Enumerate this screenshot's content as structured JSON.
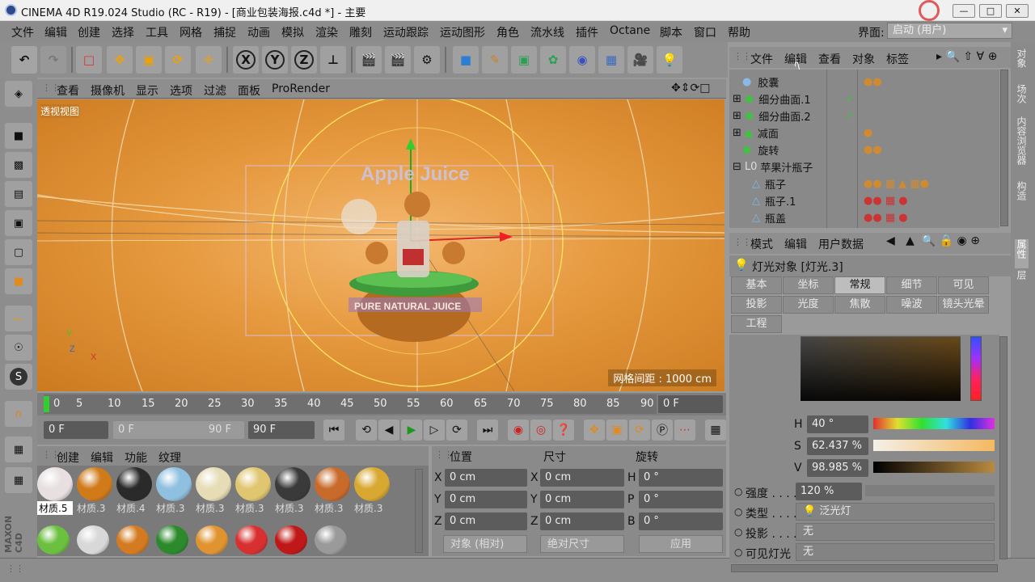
{
  "window": {
    "title": "CINEMA 4D R19.024 Studio (RC - R19) - [商业包装海报.c4d *] - 主要"
  },
  "menu": [
    "文件",
    "编辑",
    "创建",
    "选择",
    "工具",
    "网格",
    "捕捉",
    "动画",
    "模拟",
    "渲染",
    "雕刻",
    "运动跟踪",
    "运动图形",
    "角色",
    "流水线",
    "插件",
    "Octane",
    "脚本",
    "窗口",
    "帮助"
  ],
  "layout": {
    "label": "界面:",
    "value": "启动 (用户)"
  },
  "toolbar": {
    "axis_x": "X",
    "axis_y": "Y",
    "axis_z": "Z"
  },
  "viewport": {
    "menu": [
      "查看",
      "摄像机",
      "显示",
      "选项",
      "过滤",
      "面板",
      "ProRender"
    ],
    "label": "透视视图",
    "grid": "网格间距 : 1000 cm",
    "logo_text": "Apple Juice",
    "label_text": "PURE NATURAL JUICE",
    "axis_y": "Y",
    "axis_z": "Z",
    "axis_x": "X"
  },
  "timeline": {
    "ticks": [
      "0",
      "5",
      "10",
      "15",
      "20",
      "25",
      "30",
      "35",
      "40",
      "45",
      "50",
      "55",
      "60",
      "65",
      "70",
      "75",
      "80",
      "85",
      "90"
    ],
    "frame": "0 F",
    "start": "0 F",
    "range_start": "0 F",
    "range_end": "90 F",
    "end": "90 F"
  },
  "materials": {
    "menu": [
      "创建",
      "编辑",
      "功能",
      "纹理"
    ],
    "row1": [
      {
        "name": "材质.5",
        "color": "#e8e0e0"
      },
      {
        "name": "材质.3",
        "color": "#d07a1a"
      },
      {
        "name": "材质.4",
        "color": "#2a2a2a"
      },
      {
        "name": "材质.3",
        "color": "#8fc0e0"
      },
      {
        "name": "材质.3",
        "color": "#e6dcb6"
      },
      {
        "name": "材质.3",
        "color": "#e0c670"
      },
      {
        "name": "材质.3",
        "color": "#3a3a3a"
      },
      {
        "name": "材质.3",
        "color": "#c86a2a"
      },
      {
        "name": "材质.3",
        "color": "#d8a830"
      }
    ],
    "row2": [
      "#6cc040",
      "#d8d8d8",
      "#d47a20",
      "#2c8a2c",
      "#e09430",
      "#d83030",
      "#c01818",
      "#9a9a9a"
    ]
  },
  "coords": {
    "headers": [
      "位置",
      "尺寸",
      "旋转"
    ],
    "rows": [
      {
        "a": "X",
        "pos": "0 cm",
        "b": "X",
        "size": "0 cm",
        "c": "H",
        "rot": "0 °"
      },
      {
        "a": "Y",
        "pos": "0 cm",
        "b": "Y",
        "size": "0 cm",
        "c": "P",
        "rot": "0 °"
      },
      {
        "a": "Z",
        "pos": "0 cm",
        "b": "Z",
        "size": "0 cm",
        "c": "B",
        "rot": "0 °"
      }
    ],
    "mode": "对象 (相对)",
    "size_mode": "绝对尺寸",
    "apply": "应用"
  },
  "objects": {
    "menu": [
      "文件",
      "编辑",
      "查看",
      "对象",
      "标签"
    ],
    "items": [
      "胶囊",
      "细分曲面.1",
      "细分曲面.2",
      "减面",
      "旋转",
      "苹果汁瓶子",
      "瓶子",
      "瓶子.1",
      "瓶盖"
    ]
  },
  "attributes": {
    "menu": [
      "模式",
      "编辑",
      "用户数据"
    ],
    "title": "灯光对象 [灯光.3]",
    "tabs": [
      "基本",
      "坐标",
      "常规",
      "细节",
      "可见",
      "投影",
      "光度",
      "焦散",
      "噪波",
      "镜头光晕",
      "工程"
    ],
    "active_tab": "常规",
    "h_label": "H",
    "h": "40 °",
    "s_label": "S",
    "s": "62.437 %",
    "v_label": "V",
    "v": "98.985 %",
    "intensity_label": "强度 . . . . .",
    "intensity": "120 %",
    "type_label": "类型 . . . . .",
    "type": "泛光灯",
    "shadow_label": "投影 . . . . .",
    "shadow": "无",
    "visible_label": "可见灯光",
    "visible": "无"
  },
  "right_tabs": [
    "对象",
    "场次",
    "内容浏览器",
    "构造",
    "属性",
    "层"
  ],
  "colors": {
    "accent": "#e6993e",
    "ui": "#8c8c8c"
  }
}
